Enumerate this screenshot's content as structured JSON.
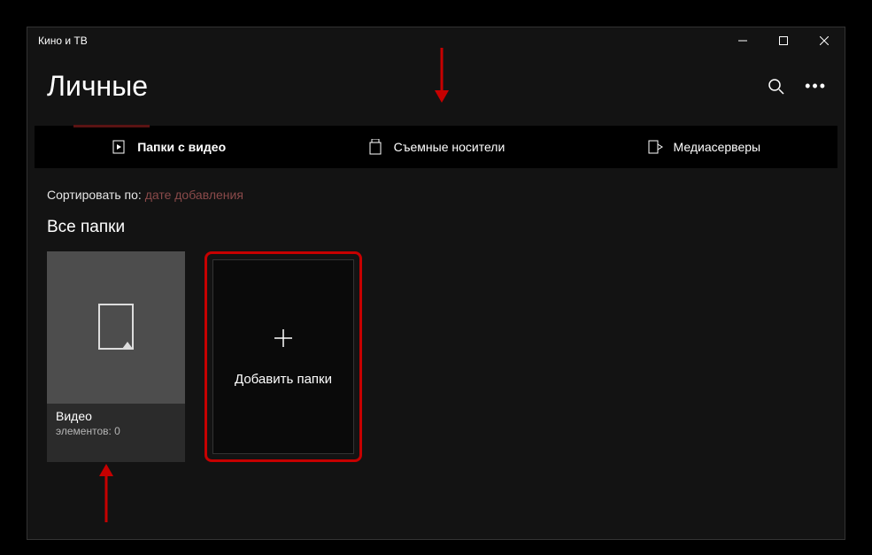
{
  "window": {
    "title": "Кино и ТВ"
  },
  "header": {
    "page_title": "Личные"
  },
  "tabs": {
    "video_folders": "Папки с видео",
    "removable": "Съемные носители",
    "mediaservers": "Медиасерверы"
  },
  "sort": {
    "label": "Сортировать по:",
    "value": "дате добавления"
  },
  "section": {
    "all_folders": "Все папки"
  },
  "tiles": {
    "video_folder": {
      "name": "Видео",
      "count_label": "элементов: 0"
    },
    "add_folder": {
      "label": "Добавить папки"
    }
  }
}
